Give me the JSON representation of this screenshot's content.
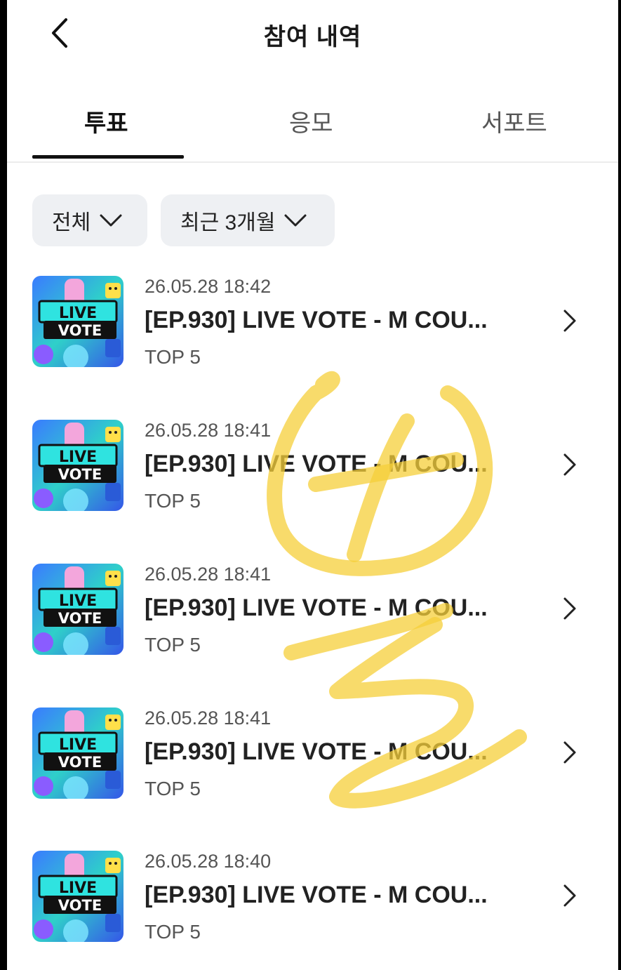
{
  "header": {
    "title": "참여 내역"
  },
  "tabs": [
    {
      "label": "투표",
      "active": true
    },
    {
      "label": "응모",
      "active": false
    },
    {
      "label": "서포트",
      "active": false
    }
  ],
  "filters": [
    {
      "label": "전체"
    },
    {
      "label": "최근 3개월"
    }
  ],
  "thumbnail": {
    "line1": "LIVE",
    "line2": "VOTE"
  },
  "items": [
    {
      "date": "26.05.28 18:42",
      "title": "[EP.930] LIVE VOTE - M COU...",
      "subtitle": "TOP 5"
    },
    {
      "date": "26.05.28 18:41",
      "title": "[EP.930] LIVE VOTE - M COU...",
      "subtitle": "TOP 5"
    },
    {
      "date": "26.05.28 18:41",
      "title": "[EP.930] LIVE VOTE - M COU...",
      "subtitle": "TOP 5"
    },
    {
      "date": "26.05.28 18:41",
      "title": "[EP.930] LIVE VOTE - M COU...",
      "subtitle": "TOP 5"
    },
    {
      "date": "26.05.28 18:40",
      "title": "[EP.930] LIVE VOTE - M COU...",
      "subtitle": "TOP 5"
    }
  ],
  "colors": {
    "scribble": "#f6cf3a",
    "chip_bg": "#eef0f3"
  },
  "icons": {
    "back": "chevron-left-icon",
    "filter_dropdown": "chevron-down-icon",
    "item_arrow": "chevron-right-icon"
  }
}
